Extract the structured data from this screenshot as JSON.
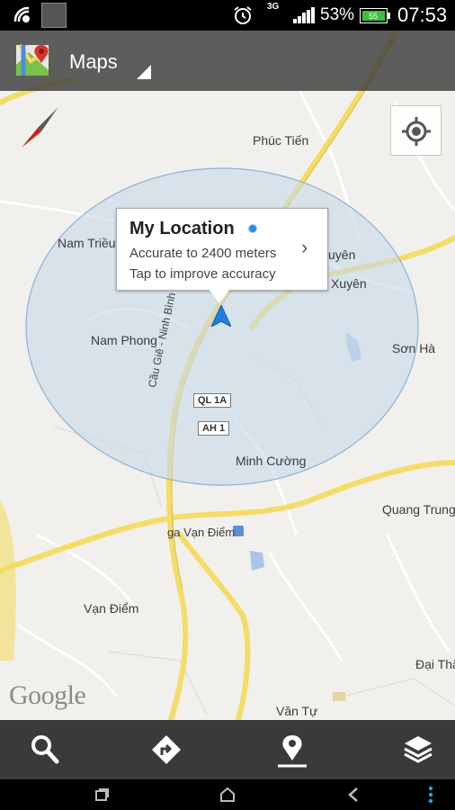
{
  "status_bar": {
    "network_type": "3G",
    "battery_percent": "53%",
    "battery_icon_label": "55",
    "time": "07:53"
  },
  "action_bar": {
    "title": "Maps"
  },
  "map": {
    "places": [
      {
        "name": "Phúc Tiến"
      },
      {
        "name": "Nam Triều"
      },
      {
        "name": "uyên"
      },
      {
        "name": "Xuyên"
      },
      {
        "name": "Nam Phong"
      },
      {
        "name": "Sơn Hà"
      },
      {
        "name": "Minh Cường"
      },
      {
        "name": "Quang Trung"
      },
      {
        "name": "ga Vạn Điểm"
      },
      {
        "name": "Vạn Điểm"
      },
      {
        "name": "Đại Thắ"
      },
      {
        "name": "Văn Tự"
      }
    ],
    "road_name": "Cầu Giẽ - Ninh Bình",
    "shields": [
      "QL 1A",
      "AH 1"
    ],
    "attribution": "Google"
  },
  "callout": {
    "title": "My Location",
    "line1": "Accurate to 2400 meters",
    "line2": "Tap to improve accuracy"
  },
  "bottom_actions": [
    "search",
    "directions",
    "places",
    "layers"
  ],
  "colors": {
    "accuracy_circle": "#c6d8ea",
    "road_major": "#f4dc66",
    "map_bg": "#f1f0ec",
    "location_arrow": "#1f80e4"
  }
}
